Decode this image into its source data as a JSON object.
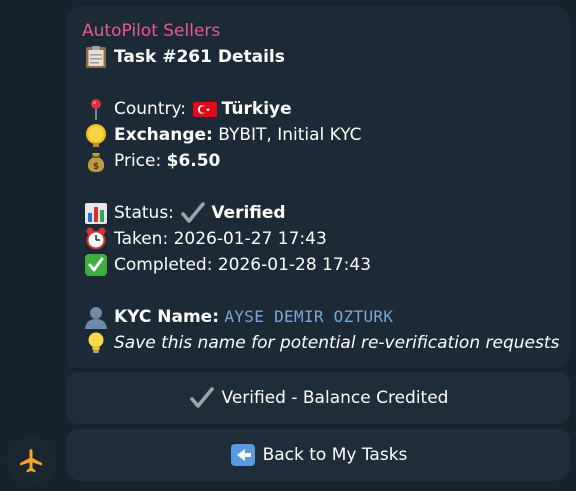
{
  "message": {
    "sender": "AutoPilot Sellers",
    "title": "Task #261 Details",
    "country_label": "Country:",
    "country_value": "Türkiye",
    "exchange_label": "Exchange:",
    "exchange_value": "BYBIT, Initial KYC",
    "price_label": "Price:",
    "price_value": "$6.50",
    "status_label": "Status:",
    "status_value": "Verified",
    "taken": "Taken: 2026-01-27 17:43",
    "completed": "Completed: 2026-01-28 17:43",
    "kyc_label": "KYC Name:",
    "kyc_value": "AYSE DEMIR OZTURK",
    "note": "Save this name for potential re-verification requests"
  },
  "keyboard": {
    "verified_button": "Verified - Balance Credited",
    "back_button": "Back to My Tasks"
  },
  "icons": {
    "title": "clipboard-icon",
    "country": "pin-icon",
    "flag": "turkey-flag-icon",
    "exchange": "medal-icon",
    "price": "money-bag-icon",
    "status": "bar-chart-icon",
    "status_check": "check-mark-icon",
    "taken": "alarm-clock-icon",
    "completed": "check-box-icon",
    "kyc": "user-silhouette-icon",
    "note": "light-bulb-icon",
    "back": "back-arrow-icon",
    "avatar": "airplane-icon"
  },
  "colors": {
    "sender": "#ea5a8f",
    "background": "#17222f",
    "bubble": "#1c2a38",
    "kyc_name": "#7aa7d8"
  }
}
